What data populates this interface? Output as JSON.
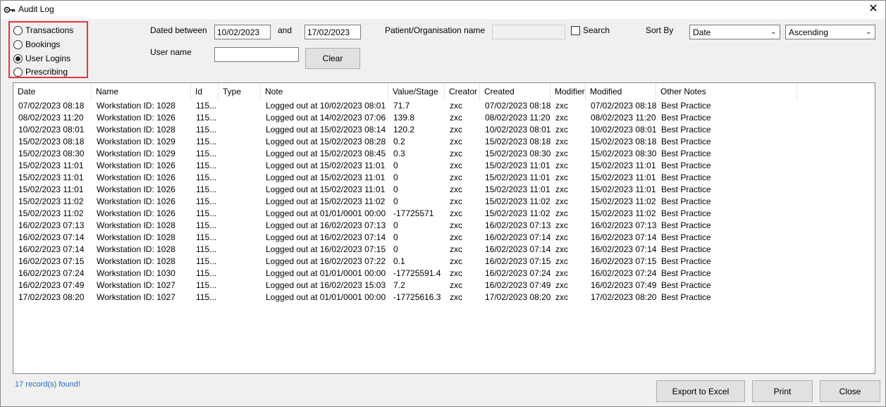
{
  "window": {
    "title": "Audit Log",
    "icon": "key-icon"
  },
  "filters": {
    "radios": [
      {
        "label": "Transactions",
        "checked": false
      },
      {
        "label": "Bookings",
        "checked": false
      },
      {
        "label": "User Logins",
        "checked": true
      },
      {
        "label": "Prescribing",
        "checked": false
      }
    ],
    "dated_between_label": "Dated between",
    "date_from": "10/02/2023",
    "and_label": "and",
    "date_to": "17/02/2023",
    "user_name_label": "User name",
    "user_name_value": "",
    "clear_label": "Clear",
    "patient_org_label": "Patient/Organisation name",
    "patient_org_value": "",
    "search_label": "Search",
    "search_checked": false,
    "sort_by_label": "Sort By",
    "sort_field": "Date",
    "sort_order": "Ascending"
  },
  "table": {
    "columns": [
      "Date",
      "Name",
      "Id",
      "Type",
      "Note",
      "Value/Stage",
      "Creator",
      "Created",
      "Modifier",
      "Modified",
      "Other Notes"
    ],
    "rows": [
      [
        "07/02/2023 08:18",
        "Workstation ID: 1028",
        "115...",
        "",
        "Logged out at 10/02/2023 08:01",
        "71.7",
        "zxc",
        "07/02/2023 08:18",
        "zxc",
        "07/02/2023 08:18",
        "Best Practice"
      ],
      [
        "08/02/2023 11:20",
        "Workstation ID: 1026",
        "115...",
        "",
        "Logged out at 14/02/2023 07:06",
        "139.8",
        "zxc",
        "08/02/2023 11:20",
        "zxc",
        "08/02/2023 11:20",
        "Best Practice"
      ],
      [
        "10/02/2023 08:01",
        "Workstation ID: 1028",
        "115...",
        "",
        "Logged out at 15/02/2023 08:14",
        "120.2",
        "zxc",
        "10/02/2023 08:01",
        "zxc",
        "10/02/2023 08:01",
        "Best Practice"
      ],
      [
        "15/02/2023 08:18",
        "Workstation ID: 1029",
        "115...",
        "",
        "Logged out at 15/02/2023 08:28",
        "0.2",
        "zxc",
        "15/02/2023 08:18",
        "zxc",
        "15/02/2023 08:18",
        "Best Practice"
      ],
      [
        "15/02/2023 08:30",
        "Workstation ID: 1029",
        "115...",
        "",
        "Logged out at 15/02/2023 08:45",
        "0.3",
        "zxc",
        "15/02/2023 08:30",
        "zxc",
        "15/02/2023 08:30",
        "Best Practice"
      ],
      [
        "15/02/2023 11:01",
        "Workstation ID: 1026",
        "115...",
        "",
        "Logged out at 15/02/2023 11:01",
        "0",
        "zxc",
        "15/02/2023 11:01",
        "zxc",
        "15/02/2023 11:01",
        "Best Practice"
      ],
      [
        "15/02/2023 11:01",
        "Workstation ID: 1026",
        "115...",
        "",
        "Logged out at 15/02/2023 11:01",
        "0",
        "zxc",
        "15/02/2023 11:01",
        "zxc",
        "15/02/2023 11:01",
        "Best Practice"
      ],
      [
        "15/02/2023 11:01",
        "Workstation ID: 1026",
        "115...",
        "",
        "Logged out at 15/02/2023 11:01",
        "0",
        "zxc",
        "15/02/2023 11:01",
        "zxc",
        "15/02/2023 11:01",
        "Best Practice"
      ],
      [
        "15/02/2023 11:02",
        "Workstation ID: 1026",
        "115...",
        "",
        "Logged out at 15/02/2023 11:02",
        "0",
        "zxc",
        "15/02/2023 11:02",
        "zxc",
        "15/02/2023 11:02",
        "Best Practice"
      ],
      [
        "15/02/2023 11:02",
        "Workstation ID: 1026",
        "115...",
        "",
        "Logged out at 01/01/0001 00:00",
        "-17725571",
        "zxc",
        "15/02/2023 11:02",
        "zxc",
        "15/02/2023 11:02",
        "Best Practice"
      ],
      [
        "16/02/2023 07:13",
        "Workstation ID: 1028",
        "115...",
        "",
        "Logged out at 16/02/2023 07:13",
        "0",
        "zxc",
        "16/02/2023 07:13",
        "zxc",
        "16/02/2023 07:13",
        "Best Practice"
      ],
      [
        "16/02/2023 07:14",
        "Workstation ID: 1028",
        "115...",
        "",
        "Logged out at 16/02/2023 07:14",
        "0",
        "zxc",
        "16/02/2023 07:14",
        "zxc",
        "16/02/2023 07:14",
        "Best Practice"
      ],
      [
        "16/02/2023 07:14",
        "Workstation ID: 1028",
        "115...",
        "",
        "Logged out at 16/02/2023 07:15",
        "0",
        "zxc",
        "16/02/2023 07:14",
        "zxc",
        "16/02/2023 07:14",
        "Best Practice"
      ],
      [
        "16/02/2023 07:15",
        "Workstation ID: 1028",
        "115...",
        "",
        "Logged out at 16/02/2023 07:22",
        "0.1",
        "zxc",
        "16/02/2023 07:15",
        "zxc",
        "16/02/2023 07:15",
        "Best Practice"
      ],
      [
        "16/02/2023 07:24",
        "Workstation ID: 1030",
        "115...",
        "",
        "Logged out at 01/01/0001 00:00",
        "-17725591.4",
        "zxc",
        "16/02/2023 07:24",
        "zxc",
        "16/02/2023 07:24",
        "Best Practice"
      ],
      [
        "16/02/2023 07:49",
        "Workstation ID: 1027",
        "115...",
        "",
        "Logged out at 16/02/2023 15:03",
        "7.2",
        "zxc",
        "16/02/2023 07:49",
        "zxc",
        "16/02/2023 07:49",
        "Best Practice"
      ],
      [
        "17/02/2023 08:20",
        "Workstation ID: 1027",
        "115...",
        "",
        "Logged out at 01/01/0001 00:00",
        "-17725616.3",
        "zxc",
        "17/02/2023 08:20",
        "zxc",
        "17/02/2023 08:20",
        "Best Practice"
      ]
    ]
  },
  "footer": {
    "status": "17 record(s) found!",
    "export_label": "Export to Excel",
    "print_label": "Print",
    "close_label": "Close"
  }
}
